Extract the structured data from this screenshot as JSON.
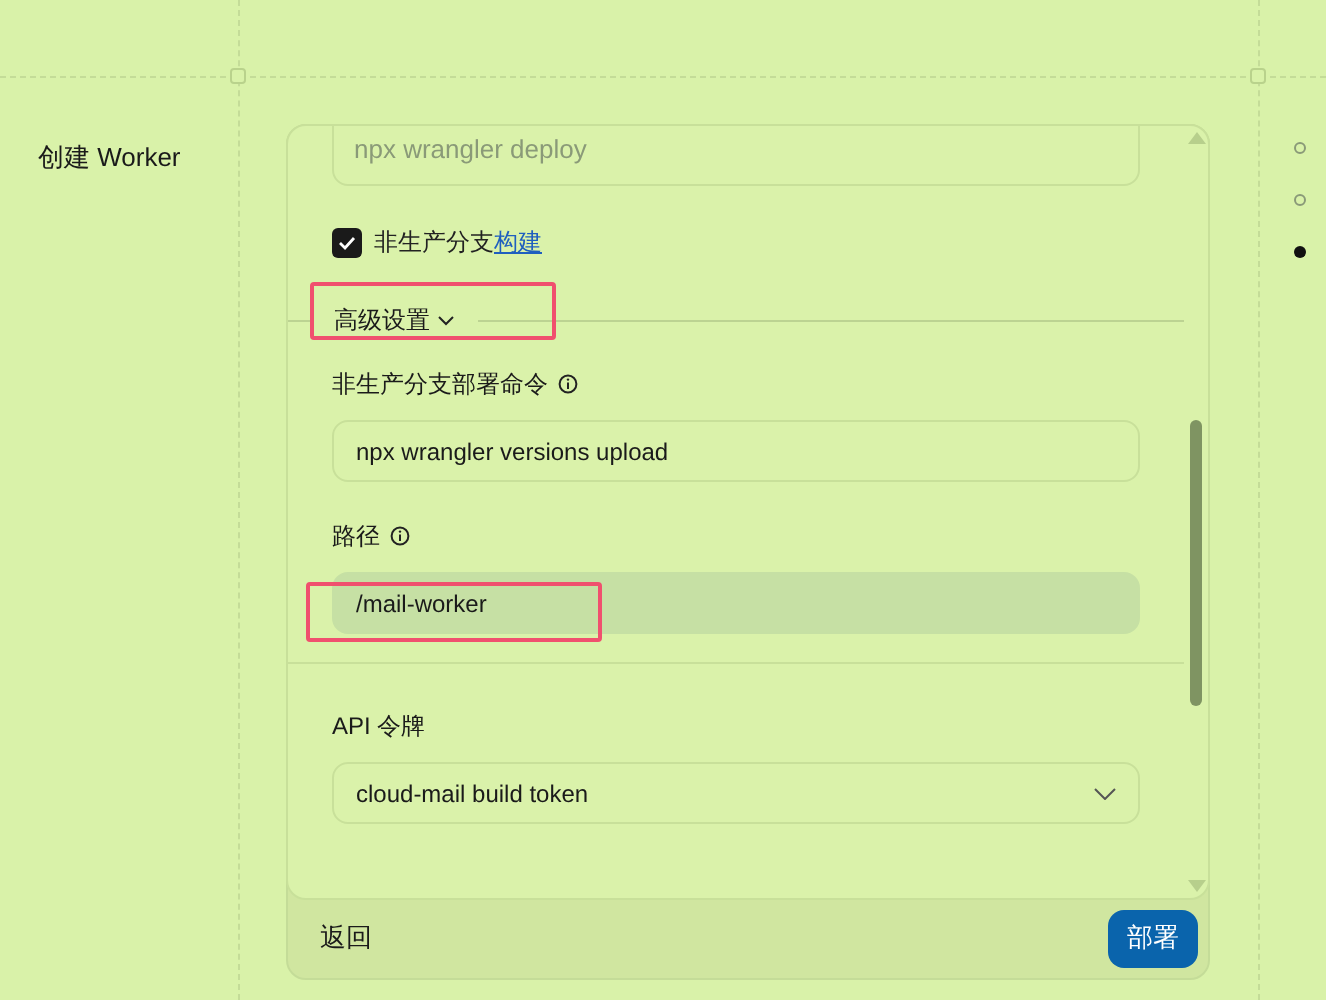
{
  "page_title": "创建 Worker",
  "deploy_command": {
    "placeholder": "npx wrangler deploy"
  },
  "non_production_build": {
    "checked": true,
    "label": "非生产分支",
    "link": "构建"
  },
  "advanced_settings": {
    "label": "高级设置",
    "expanded": true,
    "highlighted": true
  },
  "fields": [
    {
      "kind": "text",
      "label": "非生产分支部署命令",
      "info": true,
      "value": "npx wrangler versions upload",
      "disabled": false,
      "highlighted": false
    },
    {
      "kind": "text",
      "label": "路径",
      "info": true,
      "value": "/mail-worker",
      "disabled": true,
      "highlighted": true
    },
    {
      "kind": "select",
      "label": "API 令牌",
      "value": "cloud-mail build token",
      "disabled": false,
      "highlighted": false
    }
  ],
  "footer": {
    "back": "返回",
    "deploy": "部署"
  },
  "steps": [
    {
      "selected": false
    },
    {
      "selected": false
    },
    {
      "selected": true
    }
  ]
}
